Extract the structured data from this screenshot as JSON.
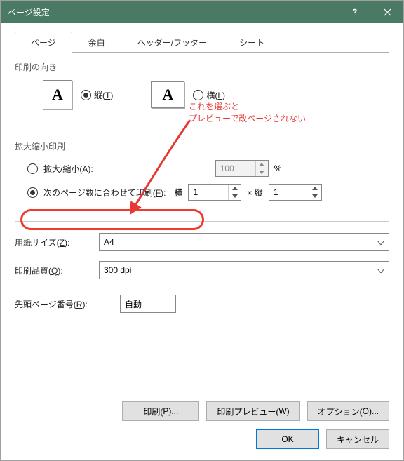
{
  "titlebar": {
    "title": "ページ設定"
  },
  "tabs": {
    "page": "ページ",
    "margins": "余白",
    "headerfooter": "ヘッダー/フッター",
    "sheet": "シート"
  },
  "orientation": {
    "group_label": "印刷の向き",
    "portrait_prefix": "縦(",
    "portrait_mn": "T",
    "portrait_suffix": ")",
    "landscape_prefix": "横(",
    "landscape_mn": "L",
    "landscape_suffix": ")"
  },
  "scaling": {
    "group_label": "拡大縮小印刷",
    "adjust_prefix": "拡大/縮小(",
    "adjust_mn": "A",
    "adjust_suffix": "):",
    "adjust_value": "100",
    "adjust_unit": "%",
    "fit_prefix": "次のページ数に合わせて印刷(",
    "fit_mn": "F",
    "fit_suffix": "):",
    "fit_wide_label": "横",
    "fit_wide_value": "1",
    "fit_times": "×  縦",
    "fit_tall_value": "1"
  },
  "paper": {
    "size_prefix": "用紙サイズ(",
    "size_mn": "Z",
    "size_suffix": "):",
    "size_value": "A4",
    "quality_prefix": "印刷品質(",
    "quality_mn": "Q",
    "quality_suffix": "):",
    "quality_value": "300 dpi",
    "firstpage_prefix": "先頭ページ番号(",
    "firstpage_mn": "R",
    "firstpage_suffix": "):",
    "firstpage_value": "自動"
  },
  "buttons": {
    "print_prefix": "印刷(",
    "print_mn": "P",
    "print_suffix": ")...",
    "preview_prefix": "印刷プレビュー(",
    "preview_mn": "W",
    "preview_suffix": ")",
    "options_prefix": "オプション(",
    "options_mn": "O",
    "options_suffix": ")...",
    "ok": "OK",
    "cancel": "キャンセル"
  },
  "annotation": {
    "line1": "これを選ぶと",
    "line2": "プレビューで改ページされない"
  }
}
